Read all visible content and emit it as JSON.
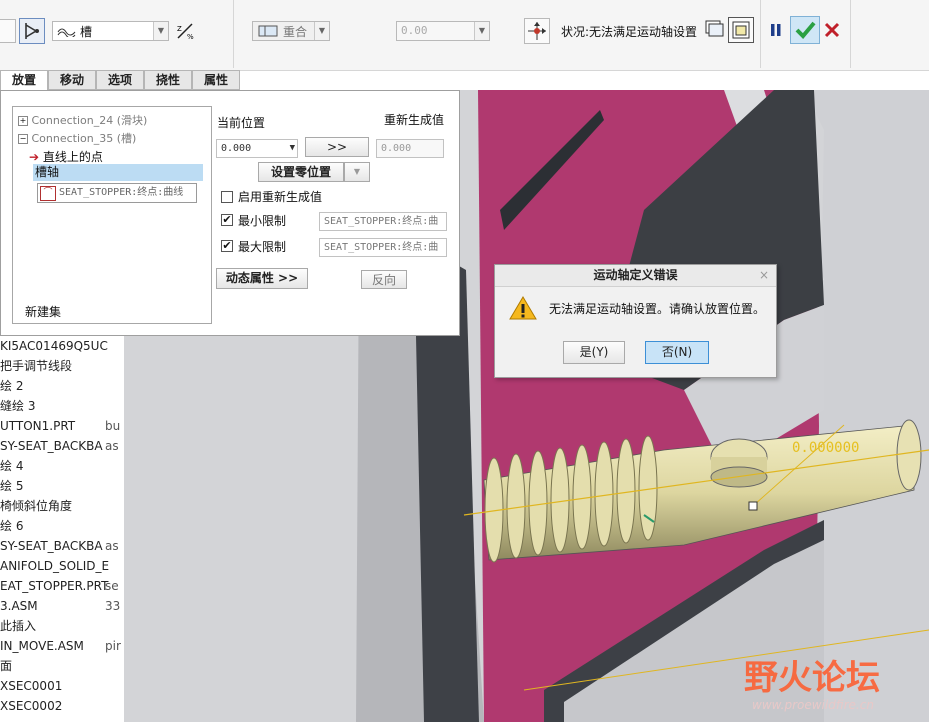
{
  "toolbar": {
    "type_select_value": "槽",
    "alignment_select_value": "重合",
    "offset_value": "0.00",
    "status_text": "状况:无法满足运动轴设置"
  },
  "tabs": [
    "放置",
    "移动",
    "选项",
    "挠性",
    "属性"
  ],
  "tree": {
    "connection_24": "Connection_24 (滑块)",
    "connection_35": "Connection_35 (槽)",
    "point_on_line": "直线上的点",
    "slot_axis": "槽轴",
    "slot_axis_reference": "SEAT_STOPPER:终点:曲线",
    "new_set": "新建集"
  },
  "motion_axis": {
    "current_position_label": "当前位置",
    "regenerate_value_label": "重新生成值",
    "current_position_value": "0.000",
    "arrow_button_label": ">>",
    "regenerate_value": "0.000",
    "set_zero_button": "设置零位置",
    "enable_regen_label": "启用重新生成值",
    "min_limit_label": "最小限制",
    "min_limit_ref": "SEAT_STOPPER:终点:曲",
    "max_limit_label": "最大限制",
    "max_limit_ref": "SEAT_STOPPER:终点:曲",
    "dynamic_props_button": "动态属性 >>",
    "flip_button": "反向"
  },
  "model_tree": [
    {
      "name": "KI5AC01469Q5UC",
      "col2": ""
    },
    {
      "name": "把手调节线段",
      "col2": ""
    },
    {
      "name": "绘 2",
      "col2": ""
    },
    {
      "name": "缝绘 3",
      "col2": ""
    },
    {
      "name": "UTTON1.PRT",
      "col2": "bu"
    },
    {
      "name": "SY-SEAT_BACKBA",
      "col2": "as"
    },
    {
      "name": "绘 4",
      "col2": ""
    },
    {
      "name": "绘 5",
      "col2": ""
    },
    {
      "name": "椅倾斜位角度",
      "col2": ""
    },
    {
      "name": "绘 6",
      "col2": ""
    },
    {
      "name": "SY-SEAT_BACKBA",
      "col2": "as"
    },
    {
      "name": "ANIFOLD_SOLID_E",
      "col2": ""
    },
    {
      "name": "EAT_STOPPER.PRT",
      "col2": "se"
    },
    {
      "name": "3.ASM",
      "col2": "33"
    },
    {
      "name": "此插入",
      "col2": ""
    },
    {
      "name": "IN_MOVE.ASM",
      "col2": "pir"
    },
    {
      "name": "面",
      "col2": ""
    },
    {
      "name": "XSEC0001",
      "col2": ""
    },
    {
      "name": "XSEC0002",
      "col2": ""
    }
  ],
  "viewport": {
    "dimension_label": "0.000000",
    "watermark_main": "野火论坛",
    "watermark_url": "www.proewildfire.cn"
  },
  "dialog": {
    "title": "运动轴定义错误",
    "message": "无法满足运动轴设置。请确认放置位置。",
    "yes_button": "是(Y)",
    "no_button": "否(N)"
  },
  "colors": {
    "magenta_part": "#b0396f",
    "pin_body": "#e2dcaa",
    "dialog_primary": "#c8e3f7",
    "confirm_green": "#2aa043",
    "cancel_red": "#c0202a"
  }
}
